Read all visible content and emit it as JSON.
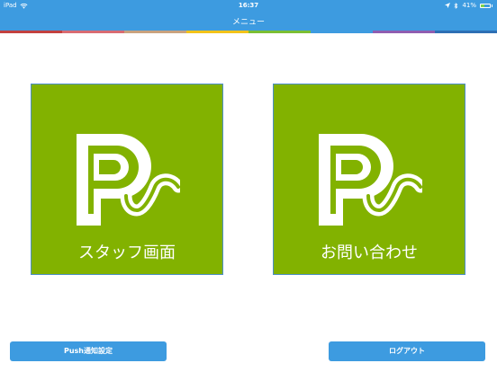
{
  "status_bar": {
    "device": "iPad",
    "time": "16:37",
    "battery_text": "41%",
    "battery_level": 0.41,
    "icons": [
      "wifi-icon",
      "location-arrow-icon",
      "bluetooth-icon",
      "battery-icon"
    ]
  },
  "nav": {
    "title": "メニュー"
  },
  "color_strip": [
    "#c2413f",
    "#d86b72",
    "#c9a27e",
    "#f2c21a",
    "#7bbf33",
    "#3d9be0",
    "#8f5db0",
    "#2e6fb4"
  ],
  "tiles": [
    {
      "label": "スタッフ画面",
      "logo": "ps-logo-icon"
    },
    {
      "label": "お問い合わせ",
      "logo": "ps-logo-icon"
    }
  ],
  "buttons": {
    "push_label": "Push通知設定",
    "logout_label": "ログアウト"
  },
  "colors": {
    "header": "#3d9be0",
    "tile_green": "#82b200",
    "tile_border": "#4d8fc8",
    "button": "#3d9be0"
  }
}
